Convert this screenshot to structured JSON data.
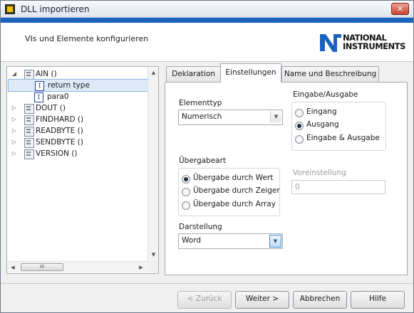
{
  "window": {
    "title": "DLL importieren"
  },
  "header": {
    "subtitle": "VIs und Elemente konfigurieren",
    "logo_line1": "NATIONAL",
    "logo_line2": "INSTRUMENTS",
    "logo_tm": "™"
  },
  "colors": {
    "accent_band": "#1a64c0",
    "selection": "#dceaf8"
  },
  "tree": {
    "items": [
      {
        "label": "AIN ()",
        "expanded": true
      },
      {
        "label": "return type",
        "selected": true,
        "icon": "I"
      },
      {
        "label": "para0",
        "icon": "I"
      },
      {
        "label": "DOUT ()",
        "expanded": false
      },
      {
        "label": "FINDHARD ()",
        "expanded": false
      },
      {
        "label": "READBYTE ()",
        "expanded": false
      },
      {
        "label": "SENDBYTE ()",
        "expanded": false
      },
      {
        "label": "VERSION ()",
        "expanded": false
      }
    ],
    "hscroll_thumb": "III"
  },
  "tabs": [
    {
      "label": "Deklaration"
    },
    {
      "label": "Einstellungen",
      "active": true
    },
    {
      "label": "Name und Beschreibung"
    }
  ],
  "settings": {
    "element_type": {
      "label": "Elementtyp",
      "value": "Numerisch"
    },
    "io": {
      "label": "Eingabe/Ausgabe",
      "options": [
        "Eingang",
        "Ausgang",
        "Eingabe & Ausgabe"
      ],
      "selected": "Ausgang"
    },
    "pass": {
      "label": "Übergabeart",
      "options": [
        "Übergabe durch Wert",
        "Übergabe durch Zeiger",
        "Übergabe durch Array"
      ],
      "selected": "Übergabe durch Wert"
    },
    "default": {
      "label": "Voreinstellung",
      "value": "0"
    },
    "representation": {
      "label": "Darstellung",
      "value": "Word"
    }
  },
  "footer": {
    "back": "< Zurück",
    "next": "Weiter >",
    "cancel": "Abbrechen",
    "help": "Hilfe"
  }
}
